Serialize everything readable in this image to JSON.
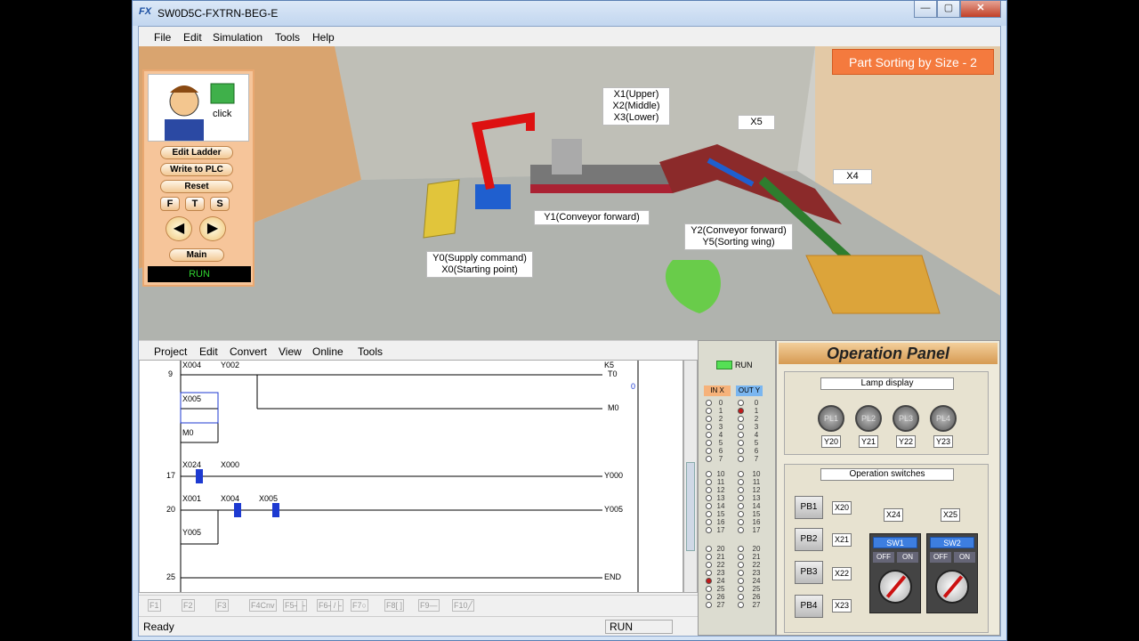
{
  "window": {
    "title": "SW0D5C-FXTRN-BEG-E",
    "icon": "fx-app-icon",
    "min": "—",
    "max": "▢",
    "close": "✕"
  },
  "menubar": [
    "File",
    "Edit",
    "Simulation",
    "Tools",
    "Help"
  ],
  "leftpanel": {
    "click_label": "click",
    "buttons": [
      "Edit Ladder",
      "Write to PLC",
      "Reset"
    ],
    "fts": [
      "F",
      "T",
      "S"
    ],
    "prev": "◀",
    "next": "▶",
    "main": "Main",
    "run": "RUN"
  },
  "scene": {
    "title": "Part Sorting by Size - 2",
    "labels": {
      "x123": [
        "X1(Upper)",
        "X2(Middle)",
        "X3(Lower)"
      ],
      "x5": "X5",
      "x4": "X4",
      "y1": "Y1(Conveyor forward)",
      "y2": [
        "Y2(Conveyor forward)",
        "Y5(Sorting wing)"
      ],
      "y0": [
        "Y0(Supply command)",
        "X0(Starting point)"
      ]
    }
  },
  "ladder_menu": [
    "Project",
    "Edit",
    "Convert",
    "View",
    "Online",
    "Tools"
  ],
  "ladder": {
    "rungs": [
      {
        "step": "9",
        "contacts": [
          "X004",
          "Y002"
        ],
        "coil": "T0",
        "const": "K5",
        "value": "0"
      },
      {
        "contacts": [
          "X005"
        ],
        "coil": "M0"
      },
      {
        "contacts": [
          "M0"
        ]
      },
      {
        "step": "17",
        "contacts": [
          "X024",
          "X000"
        ],
        "coil": "Y000"
      },
      {
        "step": "20",
        "contacts": [
          "X001",
          "X004",
          "X005"
        ],
        "coil": "Y005"
      },
      {
        "contacts": [
          "Y005"
        ]
      },
      {
        "step": "25",
        "coil": "END"
      }
    ]
  },
  "fkeys": [
    "F1",
    "F2",
    "F3",
    "F4Cnv",
    "F5┤├",
    "F6┤/├",
    "F7○",
    "F8[ ]",
    "F9—",
    "F10╱"
  ],
  "status": {
    "left": "Ready",
    "mode": "RUN"
  },
  "io": {
    "run": "RUN",
    "in_label": "IN X",
    "out_label": "OUT Y",
    "groups": [
      [
        "0",
        "1",
        "2",
        "3",
        "4",
        "5",
        "6",
        "7"
      ],
      [
        "10",
        "11",
        "12",
        "13",
        "14",
        "15",
        "16",
        "17"
      ],
      [
        "20",
        "21",
        "22",
        "23",
        "24",
        "25",
        "26",
        "27"
      ]
    ],
    "in_on": [
      "24"
    ],
    "out_on": [
      "1"
    ]
  },
  "oppanel": {
    "title": "Operation Panel",
    "lamp_title": "Lamp display",
    "lamps": [
      "PL1",
      "PL2",
      "PL3",
      "PL4"
    ],
    "lamp_y": [
      "Y20",
      "Y21",
      "Y22",
      "Y23"
    ],
    "sw_title": "Operation switches",
    "pbs": [
      "PB1",
      "PB2",
      "PB3",
      "PB4"
    ],
    "pb_x": [
      "X20",
      "X21",
      "X22",
      "X23"
    ],
    "sw_x": [
      "X24",
      "X25"
    ],
    "sw": [
      "SW1",
      "SW2"
    ],
    "off": "OFF",
    "on": "ON"
  }
}
